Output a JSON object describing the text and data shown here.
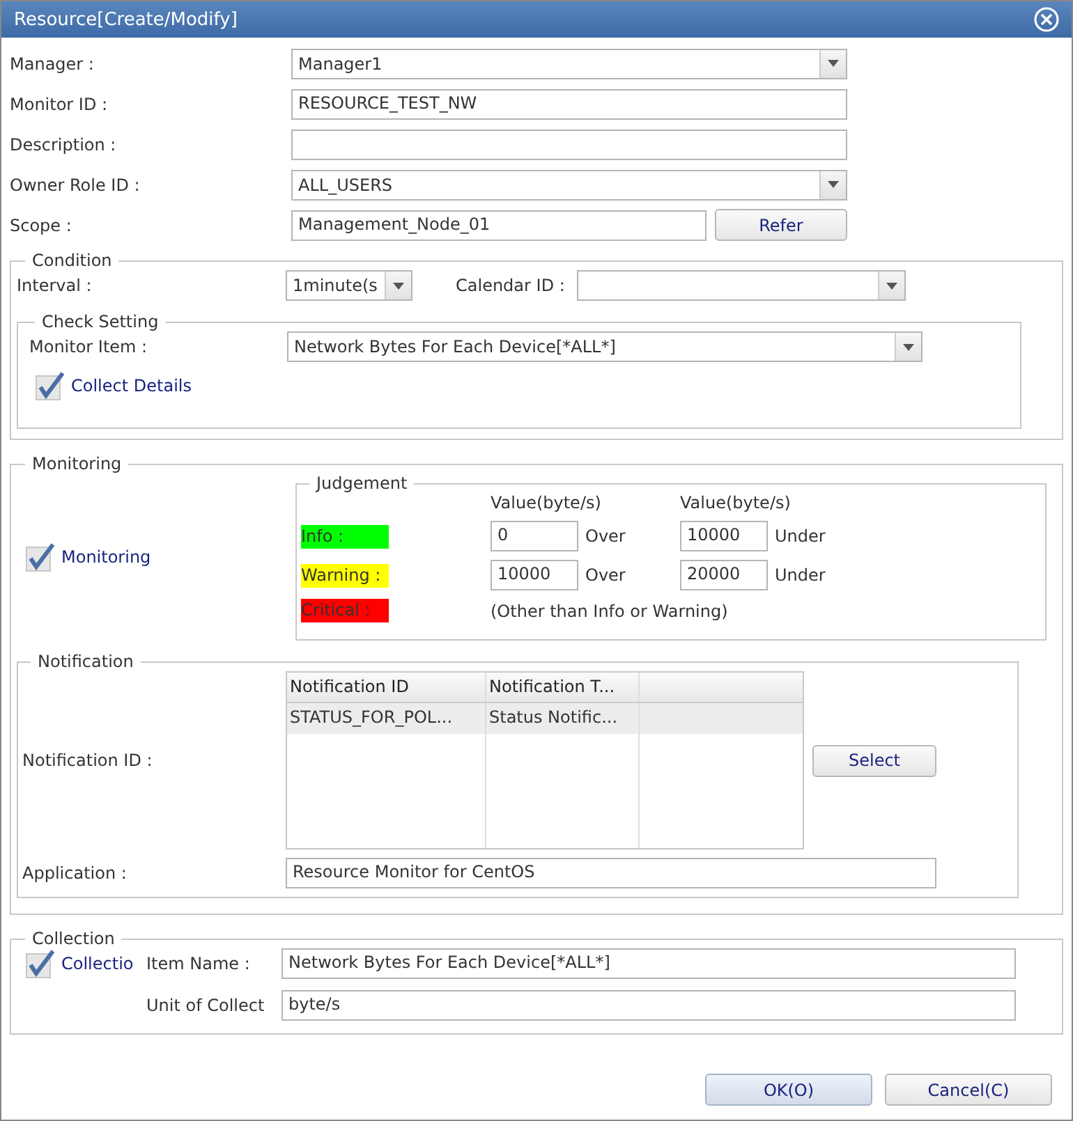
{
  "window": {
    "title": "Resource[Create/Modify]"
  },
  "fields": [
    {
      "kind": "select",
      "label": "Manager :",
      "value": "Manager1"
    },
    {
      "kind": "text",
      "label": "Monitor ID :",
      "value": "RESOURCE_TEST_NW"
    },
    {
      "kind": "text",
      "label": "Description :"
    },
    {
      "kind": "select",
      "label": "Owner Role ID :",
      "value": "ALL_USERS"
    },
    {
      "kind": "text_button",
      "label": "Scope :",
      "value": "Management_Node_01",
      "button": "Refer"
    }
  ],
  "condition": {
    "title": "Condition",
    "interval": {
      "label": "Interval :",
      "value": "1minute(s"
    },
    "calendar": {
      "label": "Calendar ID :"
    },
    "check_setting": {
      "title": "Check Setting",
      "monitor_item": {
        "label": "Monitor Item :",
        "value": "Network Bytes For Each Device[*ALL*]"
      },
      "collect_details": {
        "label": "Collect Details",
        "checked": true
      }
    }
  },
  "monitoring": {
    "title": "Monitoring",
    "monitoring": {
      "label": "Monitoring",
      "checked": true
    },
    "judgement": {
      "title": "Judgement",
      "columns": [
        "Value(byte/s)",
        "Value(byte/s)"
      ],
      "rows": [
        {
          "kind": "range",
          "label": "Info :",
          "color": "#00ff00",
          "lower": "0",
          "lower_label": "Over",
          "upper": "10000",
          "upper_label": "Under"
        },
        {
          "kind": "range",
          "label": "Warning :",
          "color": "#ffff00",
          "lower": "10000",
          "lower_label": "Over",
          "upper": "20000",
          "upper_label": "Under"
        },
        {
          "kind": "note",
          "label": "Critical :",
          "color": "#ff0000",
          "note": "(Other than Info or Warning)"
        }
      ]
    },
    "notification": {
      "title": "Notification",
      "label": "Notification ID :",
      "columns": [
        "Notification ID",
        "Notification T..."
      ],
      "rows": [
        {
          "cells": [
            "STATUS_FOR_POL...",
            "Status Notific..."
          ],
          "selected": true
        }
      ],
      "select_button": "Select",
      "application": {
        "label": "Application :",
        "value": "Resource Monitor for CentOS"
      }
    }
  },
  "collection": {
    "title": "Collection",
    "collection": {
      "label": "Collectio",
      "checked": true
    },
    "item_name": {
      "label": "Item Name :",
      "value": "Network Bytes For Each Device[*ALL*]"
    },
    "unit": {
      "label": "Unit of Collect",
      "value": "byte/s"
    }
  },
  "buttons": [
    "OK(O)",
    "Cancel(C)"
  ]
}
